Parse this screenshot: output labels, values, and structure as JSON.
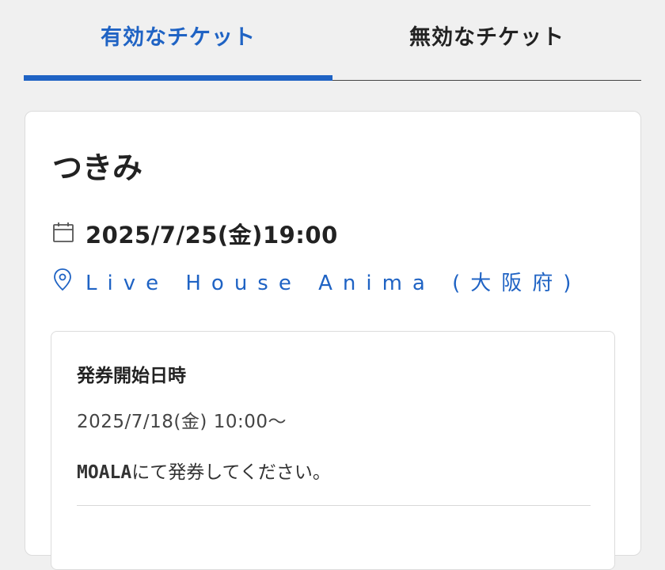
{
  "tabs": {
    "active_label": "有効なチケット",
    "inactive_label": "無効なチケット"
  },
  "colors": {
    "accent": "#1f63c4",
    "text": "#222222",
    "background": "#f0f0f0"
  },
  "ticket": {
    "artist": "つきみ",
    "datetime": "2025/7/25(金)19:00",
    "venue": "Live House Anima (大阪府)",
    "icons": {
      "date": "calendar-icon",
      "venue": "map-pin-icon"
    },
    "issue": {
      "heading": "発券開始日時",
      "start": "2025/7/18(金) 10:00〜",
      "note_brand": "MOALA",
      "note_text": "にて発券してください。"
    }
  }
}
